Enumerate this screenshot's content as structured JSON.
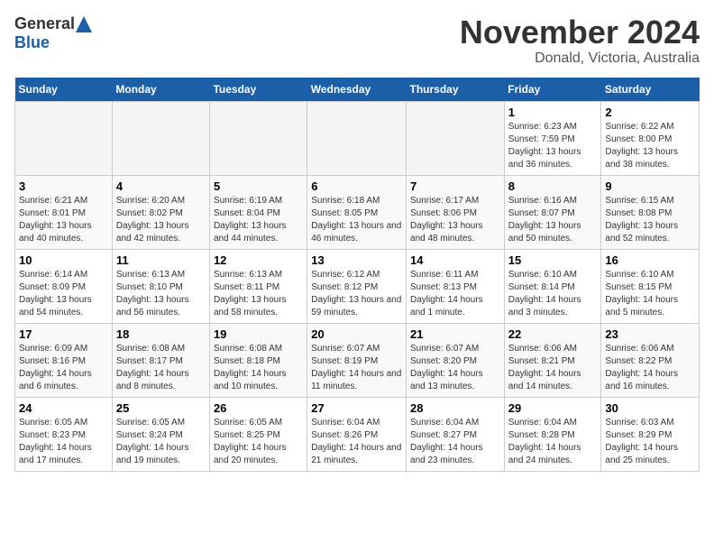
{
  "header": {
    "logo_general": "General",
    "logo_blue": "Blue",
    "month_title": "November 2024",
    "location": "Donald, Victoria, Australia"
  },
  "calendar": {
    "weekdays": [
      "Sunday",
      "Monday",
      "Tuesday",
      "Wednesday",
      "Thursday",
      "Friday",
      "Saturday"
    ],
    "weeks": [
      [
        {
          "day": "",
          "empty": true
        },
        {
          "day": "",
          "empty": true
        },
        {
          "day": "",
          "empty": true
        },
        {
          "day": "",
          "empty": true
        },
        {
          "day": "",
          "empty": true
        },
        {
          "day": "1",
          "sunrise": "6:23 AM",
          "sunset": "7:59 PM",
          "daylight": "13 hours and 36 minutes."
        },
        {
          "day": "2",
          "sunrise": "6:22 AM",
          "sunset": "8:00 PM",
          "daylight": "13 hours and 38 minutes."
        }
      ],
      [
        {
          "day": "3",
          "sunrise": "6:21 AM",
          "sunset": "8:01 PM",
          "daylight": "13 hours and 40 minutes."
        },
        {
          "day": "4",
          "sunrise": "6:20 AM",
          "sunset": "8:02 PM",
          "daylight": "13 hours and 42 minutes."
        },
        {
          "day": "5",
          "sunrise": "6:19 AM",
          "sunset": "8:04 PM",
          "daylight": "13 hours and 44 minutes."
        },
        {
          "day": "6",
          "sunrise": "6:18 AM",
          "sunset": "8:05 PM",
          "daylight": "13 hours and 46 minutes."
        },
        {
          "day": "7",
          "sunrise": "6:17 AM",
          "sunset": "8:06 PM",
          "daylight": "13 hours and 48 minutes."
        },
        {
          "day": "8",
          "sunrise": "6:16 AM",
          "sunset": "8:07 PM",
          "daylight": "13 hours and 50 minutes."
        },
        {
          "day": "9",
          "sunrise": "6:15 AM",
          "sunset": "8:08 PM",
          "daylight": "13 hours and 52 minutes."
        }
      ],
      [
        {
          "day": "10",
          "sunrise": "6:14 AM",
          "sunset": "8:09 PM",
          "daylight": "13 hours and 54 minutes."
        },
        {
          "day": "11",
          "sunrise": "6:13 AM",
          "sunset": "8:10 PM",
          "daylight": "13 hours and 56 minutes."
        },
        {
          "day": "12",
          "sunrise": "6:13 AM",
          "sunset": "8:11 PM",
          "daylight": "13 hours and 58 minutes."
        },
        {
          "day": "13",
          "sunrise": "6:12 AM",
          "sunset": "8:12 PM",
          "daylight": "13 hours and 59 minutes."
        },
        {
          "day": "14",
          "sunrise": "6:11 AM",
          "sunset": "8:13 PM",
          "daylight": "14 hours and 1 minute."
        },
        {
          "day": "15",
          "sunrise": "6:10 AM",
          "sunset": "8:14 PM",
          "daylight": "14 hours and 3 minutes."
        },
        {
          "day": "16",
          "sunrise": "6:10 AM",
          "sunset": "8:15 PM",
          "daylight": "14 hours and 5 minutes."
        }
      ],
      [
        {
          "day": "17",
          "sunrise": "6:09 AM",
          "sunset": "8:16 PM",
          "daylight": "14 hours and 6 minutes."
        },
        {
          "day": "18",
          "sunrise": "6:08 AM",
          "sunset": "8:17 PM",
          "daylight": "14 hours and 8 minutes."
        },
        {
          "day": "19",
          "sunrise": "6:08 AM",
          "sunset": "8:18 PM",
          "daylight": "14 hours and 10 minutes."
        },
        {
          "day": "20",
          "sunrise": "6:07 AM",
          "sunset": "8:19 PM",
          "daylight": "14 hours and 11 minutes."
        },
        {
          "day": "21",
          "sunrise": "6:07 AM",
          "sunset": "8:20 PM",
          "daylight": "14 hours and 13 minutes."
        },
        {
          "day": "22",
          "sunrise": "6:06 AM",
          "sunset": "8:21 PM",
          "daylight": "14 hours and 14 minutes."
        },
        {
          "day": "23",
          "sunrise": "6:06 AM",
          "sunset": "8:22 PM",
          "daylight": "14 hours and 16 minutes."
        }
      ],
      [
        {
          "day": "24",
          "sunrise": "6:05 AM",
          "sunset": "8:23 PM",
          "daylight": "14 hours and 17 minutes."
        },
        {
          "day": "25",
          "sunrise": "6:05 AM",
          "sunset": "8:24 PM",
          "daylight": "14 hours and 19 minutes."
        },
        {
          "day": "26",
          "sunrise": "6:05 AM",
          "sunset": "8:25 PM",
          "daylight": "14 hours and 20 minutes."
        },
        {
          "day": "27",
          "sunrise": "6:04 AM",
          "sunset": "8:26 PM",
          "daylight": "14 hours and 21 minutes."
        },
        {
          "day": "28",
          "sunrise": "6:04 AM",
          "sunset": "8:27 PM",
          "daylight": "14 hours and 23 minutes."
        },
        {
          "day": "29",
          "sunrise": "6:04 AM",
          "sunset": "8:28 PM",
          "daylight": "14 hours and 24 minutes."
        },
        {
          "day": "30",
          "sunrise": "6:03 AM",
          "sunset": "8:29 PM",
          "daylight": "14 hours and 25 minutes."
        }
      ]
    ]
  }
}
